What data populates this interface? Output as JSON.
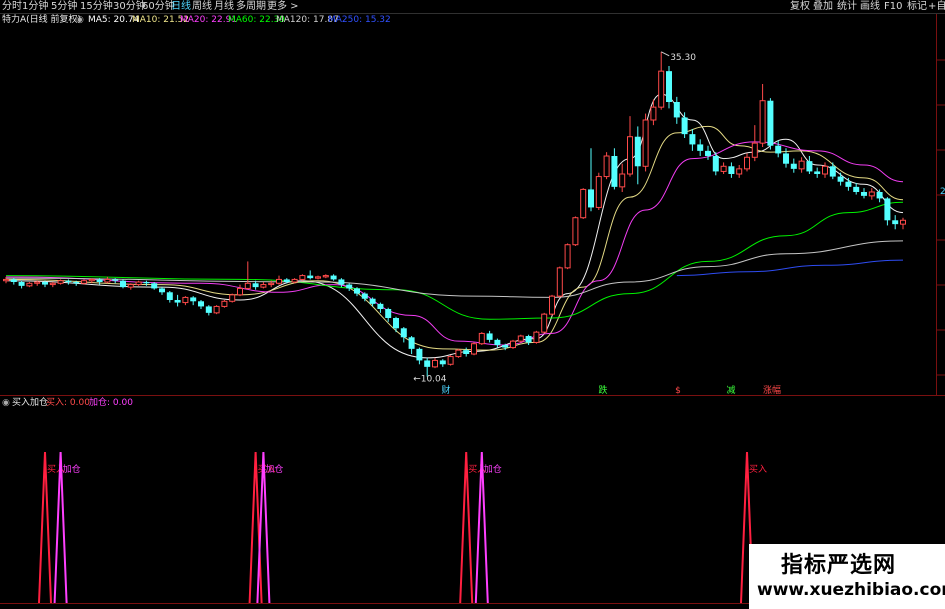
{
  "toolbar": {
    "tabs": [
      "分时",
      "1分钟",
      "5分钟",
      "15分钟",
      "30分钟",
      "60分钟",
      "日线",
      "周线",
      "月线",
      "多周期",
      "更多 >"
    ],
    "active": "日线",
    "right_tabs": [
      "复权",
      "叠加",
      "统计",
      "画线",
      "F10",
      "标记",
      "+自"
    ]
  },
  "legend": {
    "stock": "特力A(日线 前复权)",
    "ma5": "MA5: 20.74",
    "ma10": "MA10: 21.52",
    "ma20": "MA20: 22.91",
    "ma60": "MA60: 22.39",
    "ma120": "MA120: 17.87",
    "ma250": "MA250: 15.32"
  },
  "indicator_legend": {
    "name": "买入加仓",
    "buy": "买入: 0.00",
    "add": "加仓: 0.00"
  },
  "colors": {
    "up": "#ff4a4a",
    "down": "#54ffff",
    "ma5": "#ffffff",
    "ma10": "#f0e68c",
    "ma20": "#ff40ff",
    "ma60": "#00ff00",
    "ma120": "#d0d0d0",
    "ma250": "#3050ff",
    "buy_line": "#ff2040",
    "add_line": "#ff40ff"
  },
  "chart_data": {
    "type": "candlestick",
    "price_range": [
      9.0,
      37.0
    ],
    "high_label": "35.30",
    "low_label": "10.04",
    "right_axis_label": "2",
    "events": [
      "财",
      "跌",
      "$",
      "减",
      "涨幅"
    ],
    "signal_labels": [
      "买入",
      "加仓"
    ],
    "candles": [
      [
        17.5,
        17.6,
        17.8,
        17.3
      ],
      [
        17.6,
        17.4,
        17.7,
        17.2
      ],
      [
        17.4,
        17.1,
        17.5,
        16.9
      ],
      [
        17.1,
        17.3,
        17.4,
        17.0
      ],
      [
        17.3,
        17.4,
        17.5,
        17.1
      ],
      [
        17.4,
        17.2,
        17.5,
        17.0
      ],
      [
        17.2,
        17.3,
        17.4,
        17.0
      ],
      [
        17.3,
        17.5,
        17.6,
        17.2
      ],
      [
        17.5,
        17.4,
        17.6,
        17.2
      ],
      [
        17.4,
        17.3,
        17.5,
        17.1
      ],
      [
        17.3,
        17.5,
        17.6,
        17.2
      ],
      [
        17.5,
        17.6,
        17.7,
        17.3
      ],
      [
        17.6,
        17.4,
        17.7,
        17.2
      ],
      [
        17.4,
        17.6,
        17.8,
        17.3
      ],
      [
        17.6,
        17.5,
        17.7,
        17.3
      ],
      [
        17.5,
        17.0,
        17.6,
        16.9
      ],
      [
        17.0,
        17.2,
        17.3,
        16.8
      ],
      [
        17.2,
        17.4,
        17.5,
        17.1
      ],
      [
        17.4,
        17.3,
        17.5,
        17.1
      ],
      [
        17.3,
        16.9,
        17.4,
        16.8
      ],
      [
        16.9,
        16.6,
        17.0,
        16.4
      ],
      [
        16.6,
        16.0,
        16.7,
        15.8
      ],
      [
        16.0,
        15.8,
        16.4,
        15.5
      ],
      [
        15.8,
        16.2,
        16.3,
        15.6
      ],
      [
        16.2,
        15.9,
        16.3,
        15.6
      ],
      [
        15.9,
        15.5,
        16.0,
        15.3
      ],
      [
        15.5,
        15.0,
        15.6,
        14.8
      ],
      [
        15.0,
        15.5,
        15.6,
        14.9
      ],
      [
        15.5,
        15.9,
        16.0,
        15.4
      ],
      [
        15.9,
        16.4,
        16.5,
        15.8
      ],
      [
        16.4,
        16.9,
        17.2,
        16.3
      ],
      [
        16.9,
        17.3,
        19.0,
        16.8
      ],
      [
        17.3,
        17.0,
        17.5,
        16.8
      ],
      [
        17.0,
        17.2,
        17.4,
        16.9
      ],
      [
        17.2,
        17.3,
        17.5,
        17.0
      ],
      [
        17.3,
        17.6,
        17.9,
        17.2
      ],
      [
        17.6,
        17.4,
        17.7,
        17.3
      ],
      [
        17.4,
        17.6,
        17.7,
        17.3
      ],
      [
        17.6,
        17.9,
        18.0,
        17.5
      ],
      [
        17.9,
        17.7,
        18.3,
        17.6
      ],
      [
        17.7,
        17.8,
        17.9,
        17.6
      ],
      [
        17.8,
        17.9,
        18.0,
        17.7
      ],
      [
        17.9,
        17.6,
        18.0,
        17.5
      ],
      [
        17.6,
        17.2,
        17.7,
        17.0
      ],
      [
        17.2,
        16.9,
        17.3,
        16.7
      ],
      [
        16.9,
        16.5,
        17.0,
        16.3
      ],
      [
        16.5,
        16.1,
        16.6,
        15.9
      ],
      [
        16.1,
        15.7,
        16.2,
        15.5
      ],
      [
        15.7,
        15.3,
        15.8,
        15.0
      ],
      [
        15.3,
        14.6,
        15.4,
        14.3
      ],
      [
        14.6,
        13.8,
        14.7,
        13.5
      ],
      [
        13.8,
        13.1,
        13.9,
        12.7
      ],
      [
        13.1,
        12.2,
        13.2,
        11.8
      ],
      [
        12.2,
        11.3,
        12.3,
        11.0
      ],
      [
        11.3,
        10.8,
        11.5,
        10.04
      ],
      [
        10.8,
        11.3,
        11.5,
        10.7
      ],
      [
        11.3,
        11.0,
        11.4,
        10.8
      ],
      [
        11.0,
        11.6,
        11.7,
        10.9
      ],
      [
        11.6,
        12.1,
        12.2,
        11.5
      ],
      [
        12.1,
        11.8,
        12.3,
        11.6
      ],
      [
        11.8,
        12.6,
        12.7,
        11.7
      ],
      [
        12.6,
        13.4,
        13.5,
        12.5
      ],
      [
        13.4,
        12.9,
        13.6,
        12.7
      ],
      [
        12.9,
        12.5,
        13.0,
        12.3
      ],
      [
        12.5,
        12.3,
        12.6,
        12.1
      ],
      [
        12.3,
        12.8,
        12.9,
        12.2
      ],
      [
        12.8,
        13.2,
        13.3,
        12.7
      ],
      [
        13.2,
        12.7,
        13.3,
        12.5
      ],
      [
        12.7,
        13.5,
        13.6,
        12.6
      ],
      [
        13.5,
        14.9,
        15.0,
        13.4
      ],
      [
        14.9,
        16.3,
        16.4,
        14.8
      ],
      [
        16.3,
        18.5,
        18.6,
        16.2
      ],
      [
        18.5,
        20.3,
        20.4,
        18.4
      ],
      [
        20.3,
        22.4,
        22.5,
        20.2
      ],
      [
        22.4,
        24.6,
        24.7,
        22.3
      ],
      [
        24.6,
        23.2,
        27.8,
        22.9
      ],
      [
        23.2,
        25.6,
        25.9,
        23.0
      ],
      [
        25.6,
        27.2,
        27.5,
        25.4
      ],
      [
        27.2,
        24.8,
        27.8,
        24.6
      ],
      [
        24.8,
        25.8,
        26.6,
        24.4
      ],
      [
        25.8,
        28.7,
        30.3,
        25.6
      ],
      [
        28.7,
        26.4,
        29.5,
        25.0
      ],
      [
        26.4,
        30.0,
        30.5,
        26.0
      ],
      [
        30.0,
        31.0,
        31.6,
        29.6
      ],
      [
        31.0,
        33.8,
        35.3,
        30.8
      ],
      [
        33.8,
        31.4,
        34.2,
        30.9
      ],
      [
        31.4,
        30.2,
        31.8,
        29.7
      ],
      [
        30.2,
        28.9,
        30.6,
        28.6
      ],
      [
        28.9,
        28.1,
        29.3,
        27.6
      ],
      [
        28.1,
        27.6,
        28.5,
        27.2
      ],
      [
        27.6,
        27.2,
        28.0,
        26.9
      ],
      [
        27.2,
        26.0,
        27.5,
        25.7
      ],
      [
        26.0,
        26.4,
        26.7,
        25.8
      ],
      [
        26.4,
        25.8,
        26.7,
        25.5
      ],
      [
        25.8,
        26.2,
        26.5,
        25.5
      ],
      [
        26.2,
        27.1,
        27.4,
        26.0
      ],
      [
        27.1,
        28.2,
        29.6,
        26.8
      ],
      [
        28.2,
        31.5,
        32.8,
        27.9
      ],
      [
        31.5,
        28.0,
        31.7,
        27.7
      ],
      [
        28.0,
        27.4,
        28.4,
        27.1
      ],
      [
        27.4,
        26.6,
        27.8,
        26.3
      ],
      [
        26.6,
        26.2,
        27.0,
        25.9
      ],
      [
        26.2,
        26.8,
        27.1,
        25.9
      ],
      [
        26.8,
        26.0,
        27.2,
        25.8
      ],
      [
        26.0,
        25.8,
        26.3,
        25.5
      ],
      [
        25.8,
        26.4,
        26.7,
        25.5
      ],
      [
        26.4,
        25.6,
        26.7,
        25.4
      ],
      [
        25.6,
        25.2,
        25.9,
        24.9
      ],
      [
        25.2,
        24.8,
        25.5,
        24.5
      ],
      [
        24.8,
        24.4,
        25.1,
        24.2
      ],
      [
        24.4,
        24.1,
        24.7,
        23.9
      ],
      [
        24.1,
        24.4,
        24.7,
        23.8
      ],
      [
        24.4,
        23.9,
        24.6,
        23.6
      ],
      [
        23.9,
        22.2,
        24.0,
        21.8
      ],
      [
        22.2,
        21.9,
        22.6,
        21.5
      ],
      [
        21.9,
        22.2,
        22.4,
        21.5
      ]
    ],
    "ma_series": [
      {
        "name": "MA5",
        "points": [
          [
            0,
            17.5
          ],
          [
            20,
            17.0
          ],
          [
            30,
            16.0
          ],
          [
            38,
            17.5
          ],
          [
            54,
            11.5
          ],
          [
            60,
            12.0
          ],
          [
            68,
            13.0
          ],
          [
            72,
            16.5
          ],
          [
            80,
            27.0
          ],
          [
            84,
            32.0
          ],
          [
            88,
            30.0
          ],
          [
            92,
            27.0
          ],
          [
            96,
            27.5
          ],
          [
            100,
            28.5
          ],
          [
            104,
            26.5
          ],
          [
            110,
            25.0
          ],
          [
            115,
            22.8
          ]
        ]
      },
      {
        "name": "MA10",
        "points": [
          [
            0,
            17.6
          ],
          [
            20,
            17.2
          ],
          [
            30,
            16.4
          ],
          [
            40,
            17.5
          ],
          [
            56,
            12.2
          ],
          [
            62,
            12.1
          ],
          [
            68,
            12.7
          ],
          [
            74,
            17.0
          ],
          [
            80,
            24.0
          ],
          [
            86,
            29.0
          ],
          [
            90,
            29.5
          ],
          [
            94,
            28.0
          ],
          [
            98,
            27.5
          ],
          [
            102,
            27.6
          ],
          [
            110,
            25.5
          ],
          [
            115,
            23.8
          ]
        ]
      },
      {
        "name": "MA20",
        "points": [
          [
            0,
            17.8
          ],
          [
            25,
            17.3
          ],
          [
            35,
            16.6
          ],
          [
            42,
            17.2
          ],
          [
            52,
            14.8
          ],
          [
            58,
            12.8
          ],
          [
            64,
            12.5
          ],
          [
            70,
            13.4
          ],
          [
            76,
            17.5
          ],
          [
            82,
            23.0
          ],
          [
            88,
            27.0
          ],
          [
            96,
            28.3
          ],
          [
            104,
            27.6
          ],
          [
            110,
            26.5
          ],
          [
            115,
            25.2
          ]
        ]
      },
      {
        "name": "MA60",
        "points": [
          [
            0,
            17.9
          ],
          [
            30,
            17.6
          ],
          [
            50,
            16.8
          ],
          [
            62,
            14.5
          ],
          [
            70,
            14.6
          ],
          [
            80,
            16.5
          ],
          [
            90,
            19.0
          ],
          [
            100,
            21.0
          ],
          [
            108,
            22.8
          ],
          [
            115,
            23.6
          ]
        ]
      },
      {
        "name": "MA120",
        "points": [
          [
            0,
            17.7
          ],
          [
            40,
            17.4
          ],
          [
            60,
            16.3
          ],
          [
            70,
            16.2
          ],
          [
            80,
            17.4
          ],
          [
            90,
            18.6
          ],
          [
            100,
            19.6
          ],
          [
            115,
            20.6
          ]
        ]
      },
      {
        "name": "MA250",
        "points": [
          [
            86,
            17.9
          ],
          [
            95,
            18.2
          ],
          [
            105,
            18.7
          ],
          [
            115,
            19.1
          ]
        ]
      }
    ],
    "signals": [
      {
        "type": "buy",
        "x": 5
      },
      {
        "type": "add",
        "x": 7
      },
      {
        "type": "buy",
        "x": 32
      },
      {
        "type": "add",
        "x": 33
      },
      {
        "type": "buy",
        "x": 59
      },
      {
        "type": "add",
        "x": 61
      },
      {
        "type": "buy",
        "x": 95
      }
    ]
  },
  "watermark": {
    "title": "指标严选网",
    "url": "www.xuezhibiao.com"
  }
}
